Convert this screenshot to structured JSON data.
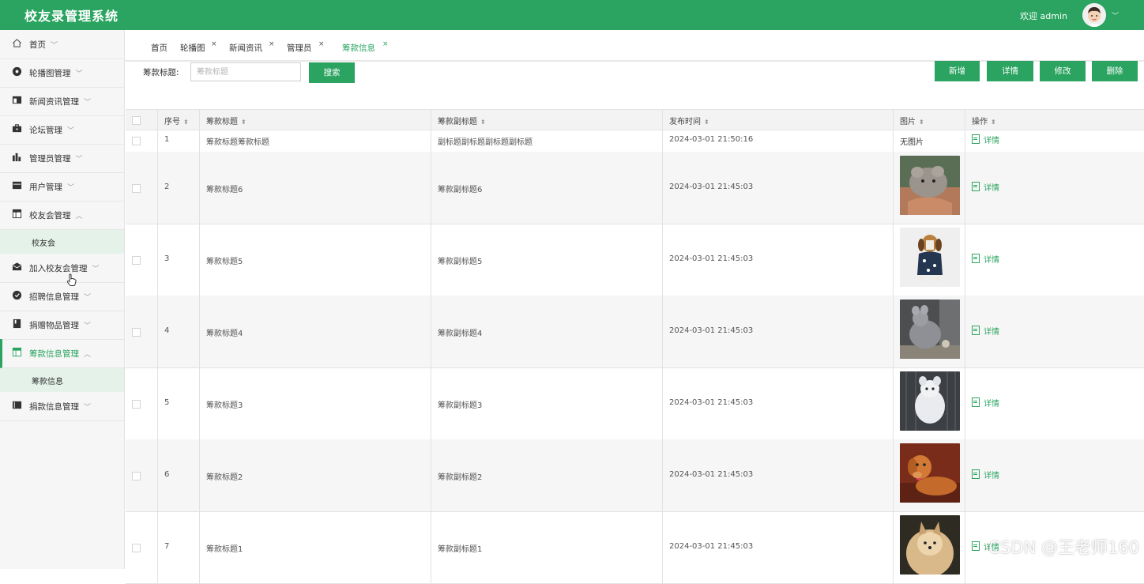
{
  "header": {
    "app_title": "校友录管理系统",
    "welcome": "欢迎 admin"
  },
  "sidebar": {
    "items": [
      {
        "label": "首页",
        "icon": "home-icon"
      },
      {
        "label": "轮播图管理",
        "icon": "circle-dot-icon"
      },
      {
        "label": "新闻资讯管理",
        "icon": "news-icon"
      },
      {
        "label": "论坛管理",
        "icon": "briefcase-icon"
      },
      {
        "label": "管理员管理",
        "icon": "bar-chart-icon"
      },
      {
        "label": "用户管理",
        "icon": "card-icon"
      },
      {
        "label": "校友会管理",
        "icon": "table-icon",
        "expanded": true,
        "sub": [
          "校友会"
        ]
      },
      {
        "label": "加入校友会管理",
        "icon": "mail-icon"
      },
      {
        "label": "招聘信息管理",
        "icon": "check-circle-icon"
      },
      {
        "label": "捐赠物品管理",
        "icon": "book-icon"
      },
      {
        "label": "筹款信息管理",
        "icon": "table-icon",
        "expanded": true,
        "active": true,
        "sub": [
          "筹款信息"
        ]
      },
      {
        "label": "捐款信息管理",
        "icon": "list-icon"
      }
    ]
  },
  "tabs": [
    {
      "label": "首页",
      "closable": false
    },
    {
      "label": "轮播图",
      "closable": true
    },
    {
      "label": "新闻资讯",
      "closable": true
    },
    {
      "label": "管理员",
      "closable": true
    },
    {
      "label": "筹款信息",
      "closable": true,
      "active": true
    }
  ],
  "tab_close_symbol": "×",
  "search": {
    "label": "筹款标题:",
    "placeholder": "筹款标题",
    "value": "",
    "button": "搜索"
  },
  "toolbar": {
    "add": "新增",
    "detail": "详情",
    "edit": "修改",
    "delete": "删除"
  },
  "table": {
    "columns": [
      "序号",
      "筹款标题",
      "筹款副标题",
      "发布时间",
      "图片",
      "操作"
    ],
    "sort_symbol": "⬍",
    "detail_label": "详情",
    "no_image_text": "无图片",
    "rows": [
      {
        "no": "1",
        "title": "筹款标题筹款标题",
        "subtitle": "副标题副标题副标题副标题",
        "time": "2024-03-01 21:50:16",
        "image": null
      },
      {
        "no": "2",
        "title": "筹款标题6",
        "subtitle": "筹款副标题6",
        "time": "2024-03-01 21:45:03",
        "image": "chinchilla-in-hand"
      },
      {
        "no": "3",
        "title": "筹款标题5",
        "subtitle": "筹款副标题5",
        "time": "2024-03-01 21:45:03",
        "image": "dog-in-jacket"
      },
      {
        "no": "4",
        "title": "筹款标题4",
        "subtitle": "筹款副标题4",
        "time": "2024-03-01 21:45:03",
        "image": "grey-chinchilla"
      },
      {
        "no": "5",
        "title": "筹款标题3",
        "subtitle": "筹款副标题3",
        "time": "2024-03-01 21:45:03",
        "image": "white-chinchilla"
      },
      {
        "no": "6",
        "title": "筹款标题2",
        "subtitle": "筹款副标题2",
        "time": "2024-03-01 21:45:03",
        "image": "golden-retriever"
      },
      {
        "no": "7",
        "title": "筹款标题1",
        "subtitle": "筹款副标题1",
        "time": "2024-03-01 21:45:03",
        "image": "fluffy-spitz"
      }
    ]
  },
  "watermark": "CSDN @王老师160",
  "colors": {
    "primary": "#2aa460",
    "sidebar_bg": "#f6f6f6",
    "submenu_bg": "#e5f2ea"
  }
}
